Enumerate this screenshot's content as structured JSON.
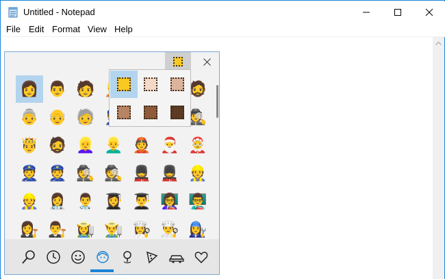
{
  "window": {
    "title": "Untitled - Notepad"
  },
  "menu": [
    "File",
    "Edit",
    "Format",
    "View",
    "Help"
  ],
  "emoji_panel": {
    "rows": [
      [
        "👩",
        "👨",
        "🧑",
        "👱",
        "👲",
        "👳",
        "🧔"
      ],
      [
        "👵",
        "👴",
        "🧓",
        "👮",
        "👷",
        "💂",
        "🕵"
      ],
      [
        "🤴",
        "🧔",
        "👱‍♀️",
        "👱‍♂️",
        "👲",
        "🎅",
        "🤶"
      ],
      [
        "👮",
        "👮",
        "🕵",
        "🕵",
        "💂",
        "💂",
        "👷"
      ],
      [
        "👷",
        "👩‍⚕️",
        "👨‍⚕️",
        "👩‍🎓",
        "👨‍🎓",
        "👩‍🏫",
        "👨‍🏫"
      ],
      [
        "👩‍⚖️",
        "👨‍⚖️",
        "👩‍🌾",
        "👨‍🌾",
        "👩‍🍳",
        "👨‍🍳",
        "👩‍🔧"
      ]
    ],
    "selected": "row0-col0",
    "tabs": [
      {
        "name": "search",
        "glyph": "⌕"
      },
      {
        "name": "recent",
        "glyph": "🕒"
      },
      {
        "name": "smileys",
        "glyph": "☺"
      },
      {
        "name": "people",
        "glyph": "☻"
      },
      {
        "name": "places",
        "glyph": "⚲"
      },
      {
        "name": "food",
        "glyph": "🍕"
      },
      {
        "name": "travel",
        "glyph": "🚗"
      },
      {
        "name": "symbols",
        "glyph": "♡"
      }
    ],
    "active_tab": "people",
    "skin_tones": [
      "#f9c923",
      "#f4d8c8",
      "#dcb39c",
      "#b98463",
      "#8e5a39",
      "#5c3a24"
    ]
  }
}
